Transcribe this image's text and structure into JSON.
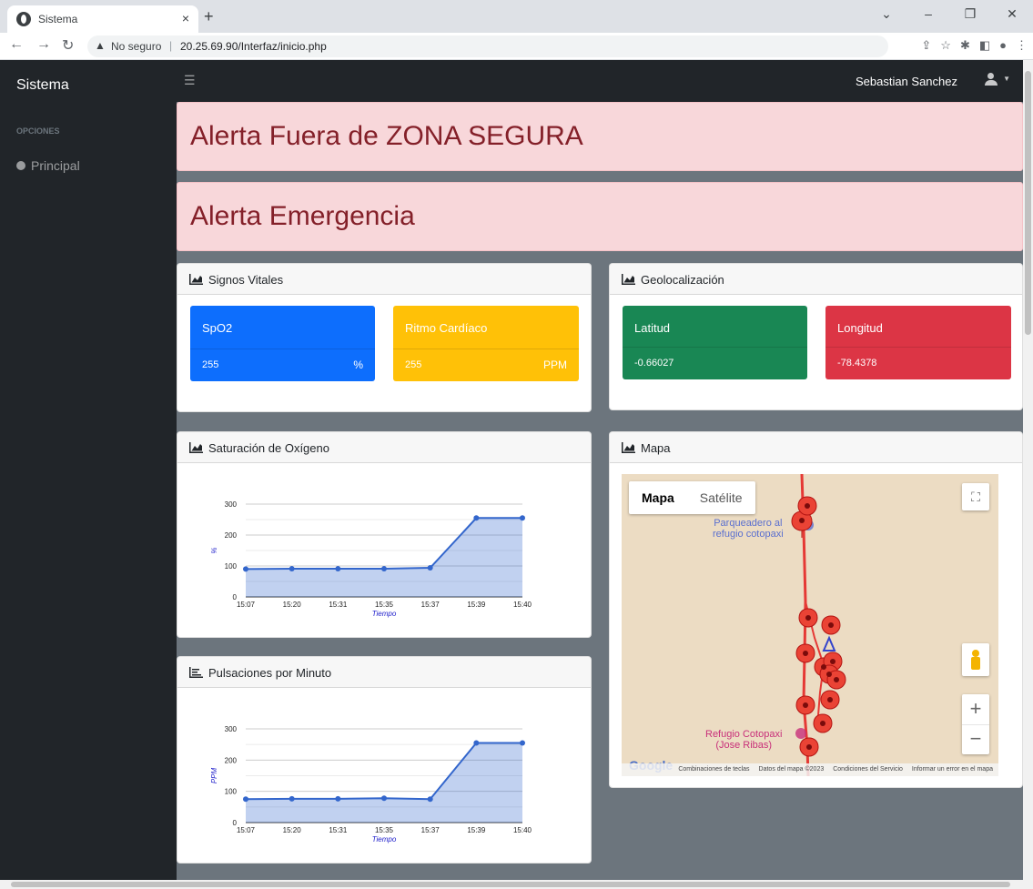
{
  "browser": {
    "tab_title": "Sistema",
    "tab_close": "×",
    "new_tab": "+",
    "security_label": "No seguro",
    "url": "20.25.69.90/Interfaz/inicio.php"
  },
  "app": {
    "brand": "Sistema",
    "sidebar_heading": "OPCIONES",
    "sidebar_items": [
      {
        "label": "Principal"
      }
    ],
    "user_name": "Sebastian Sanchez"
  },
  "alerts": [
    {
      "text": "Alerta Fuera de ZONA SEGURA"
    },
    {
      "text": "Alerta Emergencia"
    }
  ],
  "vitals": {
    "title": "Signos Vitales",
    "spo2": {
      "label": "SpO2",
      "value": "255",
      "unit": "%",
      "color": "#0d6efd"
    },
    "heart": {
      "label": "Ritmo Cardíaco",
      "value": "255",
      "unit": "PPM",
      "color": "#ffc107"
    }
  },
  "geo": {
    "title": "Geolocalización",
    "lat": {
      "label": "Latitud",
      "value": "-0.66027",
      "color": "#198754"
    },
    "lon": {
      "label": "Longitud",
      "value": "-78.4378",
      "color": "#dc3545"
    }
  },
  "map": {
    "title": "Mapa",
    "type_map": "Mapa",
    "type_satellite": "Satélite",
    "poi_top": "Parqueadero al\nrefugio cotopaxi",
    "poi_bottom": "Refugio Cotopaxi\n(Jose Ribas)",
    "google": "Google",
    "attribution": [
      "Combinaciones de teclas",
      "Datos del mapa ©2023",
      "Condiciones del Servicio",
      "Informar un error en el mapa"
    ],
    "zoom_in": "+",
    "zoom_out": "−"
  },
  "chart_data": [
    {
      "type": "area",
      "title": "Saturación de Oxígeno",
      "xlabel": "Tiempo",
      "ylabel": "%",
      "categories": [
        "15:07",
        "15:20",
        "15:31",
        "15:35",
        "15:37",
        "15:39",
        "15:40"
      ],
      "values": [
        90,
        91,
        91,
        91,
        94,
        255,
        255
      ],
      "yticks": [
        0,
        100,
        200,
        300
      ],
      "ylim": [
        0,
        300
      ],
      "color": "#3366cc"
    },
    {
      "type": "area",
      "title": "Pulsaciones por Minuto",
      "xlabel": "Tiempo",
      "ylabel": "PPM",
      "categories": [
        "15:07",
        "15:20",
        "15:31",
        "15:35",
        "15:37",
        "15:39",
        "15:40"
      ],
      "values": [
        75,
        76,
        76,
        78,
        75,
        255,
        255
      ],
      "yticks": [
        0,
        100,
        200,
        300
      ],
      "ylim": [
        0,
        300
      ],
      "color": "#3366cc"
    }
  ]
}
